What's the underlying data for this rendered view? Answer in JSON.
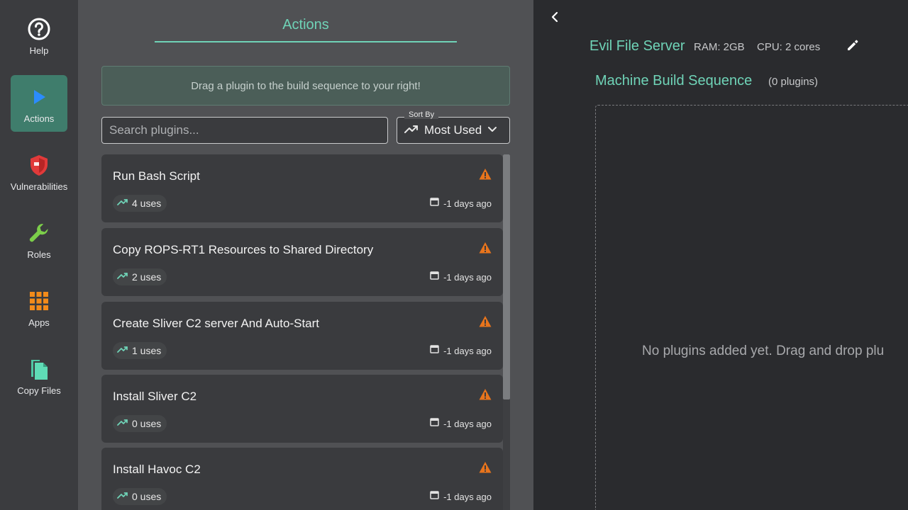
{
  "rail": {
    "items": [
      {
        "label": "Help",
        "icon": "help-circle-icon"
      },
      {
        "label": "Actions",
        "icon": "play-icon",
        "active": true
      },
      {
        "label": "Vulnerabilities",
        "icon": "shield-icon"
      },
      {
        "label": "Roles",
        "icon": "wrench-icon"
      },
      {
        "label": "Apps",
        "icon": "grid-icon"
      },
      {
        "label": "Copy Files",
        "icon": "files-icon"
      }
    ]
  },
  "panel": {
    "tab_title": "Actions",
    "hint": "Drag a plugin to the build sequence to your right!",
    "search_placeholder": "Search plugins...",
    "sort": {
      "legend": "Sort By",
      "value": "Most Used"
    },
    "plugins": [
      {
        "title": "Run Bash Script",
        "uses": "4 uses",
        "date": "-1 days ago"
      },
      {
        "title": "Copy ROPS-RT1 Resources to Shared Directory",
        "uses": "2 uses",
        "date": "-1 days ago"
      },
      {
        "title": "Create Sliver C2 server And Auto-Start",
        "uses": "1 uses",
        "date": "-1 days ago"
      },
      {
        "title": "Install Sliver C2",
        "uses": "0 uses",
        "date": "-1 days ago"
      },
      {
        "title": "Install Havoc C2",
        "uses": "0 uses",
        "date": "-1 days ago"
      }
    ]
  },
  "workspace": {
    "machine_name": "Evil File Server",
    "ram": "RAM: 2GB",
    "cpu": "CPU: 2 cores",
    "sequence_title": "Machine Build Sequence",
    "sequence_count": "(0 plugins)",
    "empty_message": "No plugins added yet. Drag and drop plu"
  },
  "colors": {
    "accent": "#6fd3b7",
    "active_nav": "#3f7d6c",
    "warning": "#e8741c"
  }
}
